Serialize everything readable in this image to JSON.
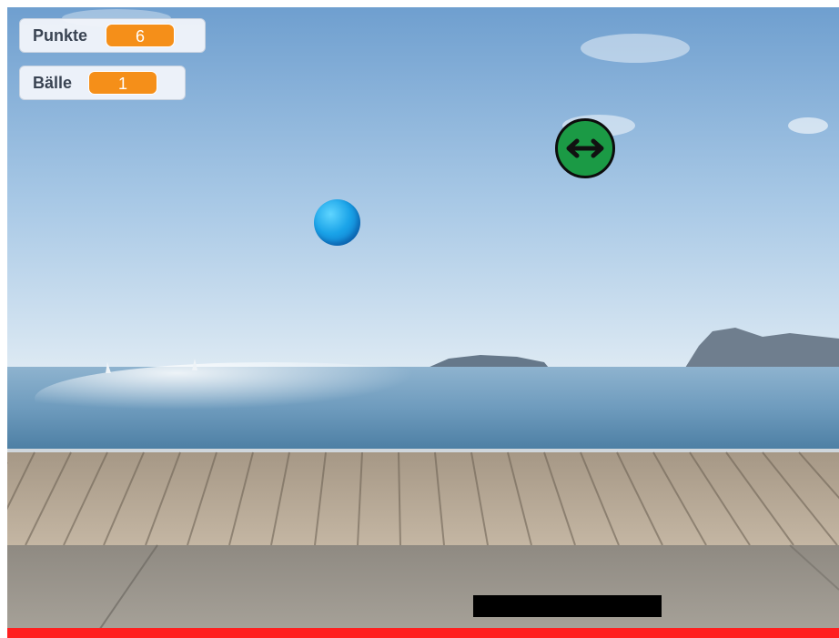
{
  "monitors": {
    "score": {
      "label": "Punkte",
      "value": "6"
    },
    "balls": {
      "label": "Bälle",
      "value": "1"
    }
  },
  "sprites": {
    "ball": {
      "icon": "ball-icon",
      "color": "#1aa3e8"
    },
    "direction_button": {
      "icon": "left-right-arrow-icon",
      "color": "#1b9a45"
    },
    "paddle": {
      "color": "#000000"
    },
    "baseline": {
      "color": "#ff1f1f"
    }
  },
  "colors": {
    "monitor_value_bg": "#f58f19",
    "sky": "#9fc4e6",
    "sea": "#5f8fb3",
    "boardwalk": "#b7a896",
    "pavement": "#9a958c"
  }
}
